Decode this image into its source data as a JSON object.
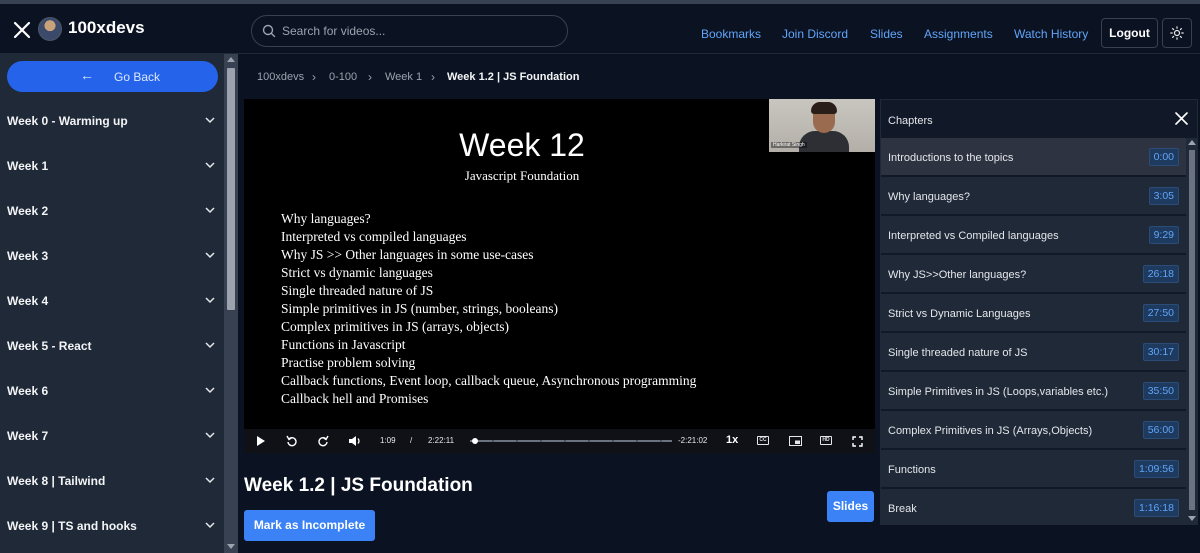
{
  "header": {
    "brand": "100xdevs",
    "search_placeholder": "Search for videos...",
    "nav": [
      "Bookmarks",
      "Join Discord",
      "Slides",
      "Assignments",
      "Watch History"
    ],
    "logout": "Logout",
    "accent": "#60a5fa"
  },
  "sidebar": {
    "go_back": "Go Back",
    "weeks": [
      "Week 0 - Warming up",
      "Week 1",
      "Week 2",
      "Week 3",
      "Week 4",
      "Week 5 - React",
      "Week 6",
      "Week 7",
      "Week 8 | Tailwind",
      "Week 9 | TS and hooks"
    ]
  },
  "breadcrumb": [
    "100xdevs",
    "0-100",
    "Week 1",
    "Week 1.2 | JS Foundation"
  ],
  "video": {
    "slide_title": "Week 12",
    "slide_subtitle": "Javascript Foundation",
    "slide_points": [
      "Why languages?",
      "Interpreted vs compiled languages",
      "Why JS >> Other languages in some use-cases",
      "Strict vs dynamic languages",
      "Single threaded nature of JS",
      "Simple primitives in JS (number, strings, booleans)",
      "Complex primitives in JS (arrays, objects)",
      "Functions in Javascript",
      "Practise problem solving",
      "Callback functions, Event loop, callback queue, Asynchronous programming",
      "Callback hell and Promises"
    ],
    "presenter_name": "Harkirat Singh",
    "current_time": "1:09",
    "separator": "/",
    "duration": "2:22:11",
    "remaining": "-2:21:02",
    "speed": "1x",
    "progress": 0.008,
    "cc_label": "CC",
    "hd_label": "HD"
  },
  "page": {
    "title": "Week 1.2 | JS Foundation",
    "mark_button": "Mark as Incomplete",
    "slides_button": "Slides"
  },
  "chapters": {
    "title": "Chapters",
    "items": [
      {
        "name": "Introductions to the topics",
        "time": "0:00"
      },
      {
        "name": "Why languages?",
        "time": "3:05"
      },
      {
        "name": "Interpreted vs Compiled languages",
        "time": "9:29"
      },
      {
        "name": "Why JS>>Other languages?",
        "time": "26:18"
      },
      {
        "name": "Strict vs Dynamic Languages",
        "time": "27:50"
      },
      {
        "name": "Single threaded nature of JS",
        "time": "30:17"
      },
      {
        "name": "Simple Primitives in JS (Loops,variables etc.)",
        "time": "35:50"
      },
      {
        "name": "Complex Primitives in JS (Arrays,Objects)",
        "time": "56:00"
      },
      {
        "name": "Functions",
        "time": "1:09:56"
      },
      {
        "name": "Break",
        "time": "1:16:18"
      }
    ]
  }
}
